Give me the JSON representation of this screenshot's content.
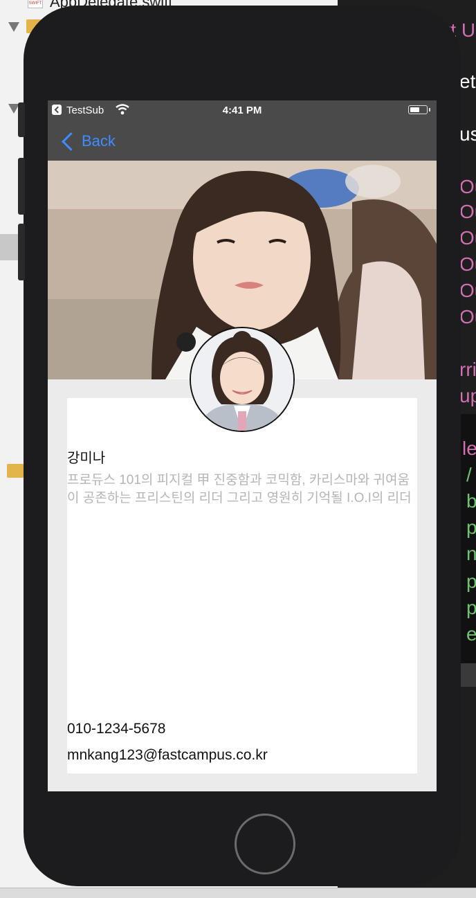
{
  "xcode": {
    "file_name": "AppDelegate.swift",
    "code_fragments": [
      {
        "text": "rt U",
        "color": "#d06fb2"
      },
      {
        "text": "et",
        "color": "#ffffff"
      },
      {
        "text": "us",
        "color": "#ffffff"
      },
      {
        "text": "Ou",
        "color": "#d06fb2"
      },
      {
        "text": "Ou",
        "color": "#d06fb2"
      },
      {
        "text": "Ou",
        "color": "#d06fb2"
      },
      {
        "text": "Ou",
        "color": "#d06fb2"
      },
      {
        "text": "Ou",
        "color": "#d06fb2"
      },
      {
        "text": "Ou",
        "color": "#d06fb2"
      },
      {
        "text": "rri",
        "color": "#d06fb2"
      },
      {
        "text": "up",
        "color": "#d06fb2"
      },
      {
        "text": "le",
        "color": "#d06fb2"
      },
      {
        "text": "/",
        "color": "#6fc26f"
      },
      {
        "text": "b",
        "color": "#6fc26f"
      },
      {
        "text": "p",
        "color": "#6fc26f"
      },
      {
        "text": "n",
        "color": "#6fc26f"
      },
      {
        "text": "p",
        "color": "#6fc26f"
      },
      {
        "text": "p",
        "color": "#6fc26f"
      },
      {
        "text": "e",
        "color": "#6fc26f"
      }
    ]
  },
  "status_bar": {
    "carrier": "TestSub",
    "time": "4:41 PM",
    "battery_level": 0.6
  },
  "nav": {
    "back_label": "Back"
  },
  "profile": {
    "name": "강미나",
    "description": "프로듀스 101의 피지컬 甲 진중함과 코믹함, 카리스마와 귀여움이 공존하는 프리스틴의 리더 그리고 영원히 기억될 I.O.I의 리더",
    "phone": "010-1234-5678",
    "email": "mnkang123@fastcampus.co.kr"
  },
  "colors": {
    "accent": "#3f8cff",
    "nav_background": "#4a4a4a",
    "description_text": "#b5b5b5"
  },
  "icons": [
    "back-chevron-icon",
    "wifi-icon",
    "battery-icon",
    "home-button"
  ]
}
